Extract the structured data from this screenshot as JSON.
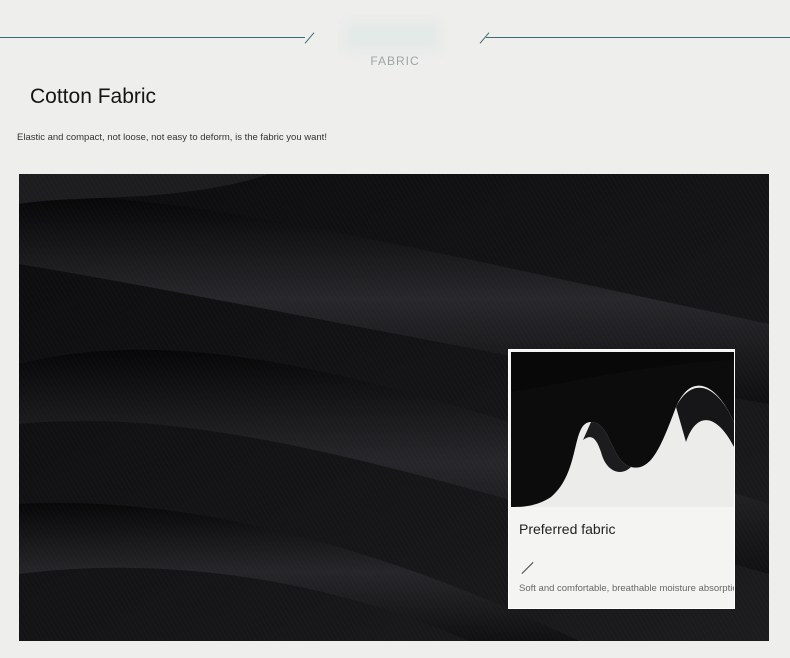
{
  "header": {
    "tag": "FABRIC",
    "title": "Cotton Fabric",
    "subtitle": "Elastic and compact, not loose, not easy to deform, is the fabric you want!"
  },
  "inset": {
    "title": "Preferred fabric",
    "description": "Soft and comfortable, breathable moisture absorption, good w"
  },
  "colors": {
    "background": "#eeeeec",
    "accent_line": "#3d6b73",
    "fabric_dark": "#141416"
  }
}
